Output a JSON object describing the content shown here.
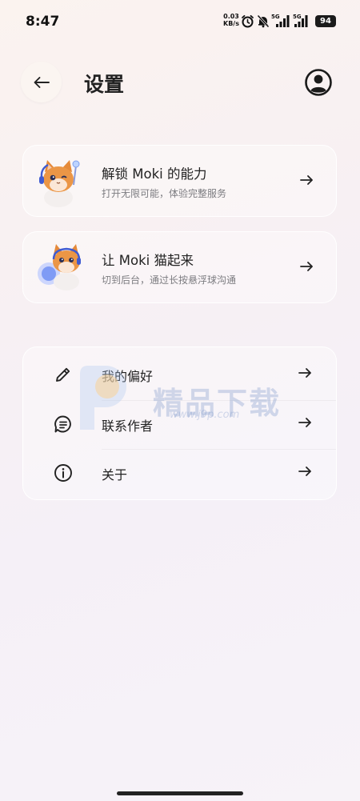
{
  "status_bar": {
    "time": "8:47",
    "net_speed_value": "0.03",
    "net_speed_unit": "KB/s",
    "signal_1_label": "5G",
    "signal_2_label": "5G",
    "battery": "94"
  },
  "header": {
    "title": "设置",
    "back_icon": "arrow-left-icon",
    "profile_icon": "account-circle-icon"
  },
  "cards": [
    {
      "title": "解锁 Moki 的能力",
      "subtitle": "打开无限可能，体验完整服务",
      "icon": "cat-mascot-magic-wand"
    },
    {
      "title": "让 Moki 猫起来",
      "subtitle": "切到后台，通过长按悬浮球沟通",
      "icon": "cat-mascot-floating-ball"
    }
  ],
  "settings": [
    {
      "label": "我的偏好",
      "icon": "pencil-icon"
    },
    {
      "label": "联系作者",
      "icon": "message-lines-icon"
    },
    {
      "label": "关于",
      "icon": "info-icon"
    }
  ],
  "watermark": {
    "text": "精品下载",
    "url": "www.j9p.com"
  },
  "colors": {
    "background": "#f7f1f3",
    "text": "#222222",
    "subtext": "#7c7c80",
    "card_border": "#ffffff"
  }
}
